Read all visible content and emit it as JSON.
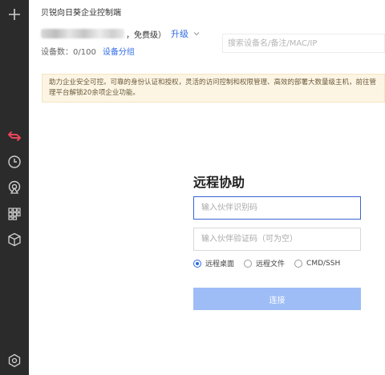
{
  "app": {
    "title": "贝锐向日葵企业控制端"
  },
  "account": {
    "plan": "，免费级）",
    "upgrade_label": "升级"
  },
  "devices": {
    "count_text": "设备数：0/100",
    "group_label": "设备分组"
  },
  "search": {
    "placeholder": "搜索设备名/备注/MAC/IP"
  },
  "banner": {
    "text": "助力企业安全可控。可靠的身份认证和授权，灵活的访问控制和权限管理、高效的部署大数量级主机，前往管理平台解锁20余项企业功能。"
  },
  "remote": {
    "title": "远程协助",
    "partner_id_placeholder": "输入伙伴识别码",
    "verify_code_placeholder": "输入伙伴验证码（可为空）",
    "modes": [
      {
        "label": "远程桌面",
        "checked": true
      },
      {
        "label": "远程文件",
        "checked": false
      },
      {
        "label": "CMD/SSH",
        "checked": false
      }
    ],
    "connect_label": "连接"
  },
  "sidebar": {
    "icons": [
      "plus-icon",
      "remote-arrows-icon",
      "history-clock-icon",
      "broadcast-icon",
      "apps-grid-icon",
      "cube-icon",
      "settings-icon"
    ],
    "active_color": "#e8455a"
  },
  "colors": {
    "accent": "#2f6be6",
    "connect_disabled": "#9ebdf6",
    "banner_bg": "#fdf5e4"
  }
}
